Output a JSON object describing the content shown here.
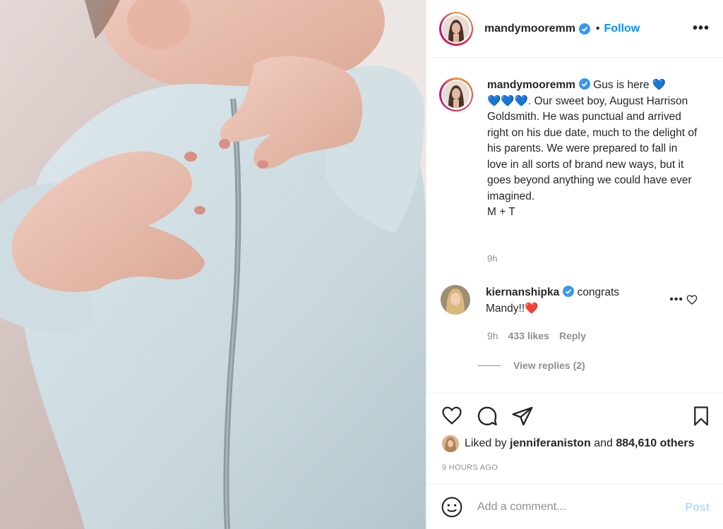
{
  "header": {
    "username": "mandymooremm",
    "separator": "•",
    "follow_label": "Follow",
    "more_icon": "ellipsis-icon"
  },
  "caption": {
    "username": "mandymooremm",
    "text_before": "Gus is here ",
    "hearts_line": "💙",
    "text_after": ". Our sweet boy, August Harrison Goldsmith. He was punctual and arrived right on his due date, much to the delight of his parents. We were prepared to fall in love in all sorts of brand new ways, but it goes beyond anything we could have ever imagined.",
    "signoff": "M + T",
    "time": "9h"
  },
  "comment": {
    "username": "kiernanshipka",
    "text": "congrats Mandy!!",
    "heart": "❤️",
    "time": "9h",
    "likes": "433 likes",
    "reply_label": "Reply",
    "view_replies": "View replies (2)"
  },
  "likes": {
    "prefix": "Liked by",
    "user": "jenniferaniston",
    "connector": "and",
    "others": "884,610 others"
  },
  "timestamp": "9 HOURS AGO",
  "add_comment": {
    "placeholder": "Add a comment...",
    "post_label": "Post"
  },
  "colors": {
    "link_blue": "#0095f6",
    "verified_blue": "#3897f0",
    "muted": "#8e8e8e",
    "post_disabled": "#b2dffc"
  }
}
